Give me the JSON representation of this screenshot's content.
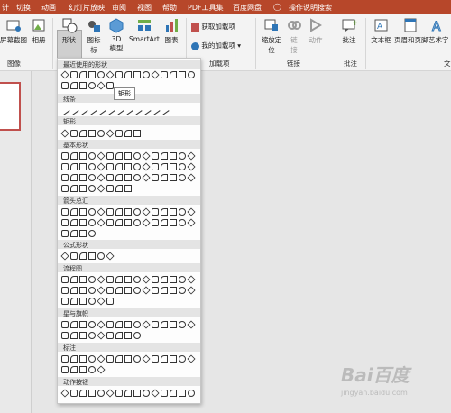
{
  "menu_tabs": [
    "计",
    "切换",
    "动画",
    "幻灯片放映",
    "审阅",
    "视图",
    "帮助",
    "PDF工具集",
    "百度网盘"
  ],
  "tell_me": "操作说明搜索",
  "ribbon": {
    "screenshot_top": "屏幕截图",
    "album": "相册",
    "shapes": "形状",
    "icons": "图标",
    "icons2": "标",
    "model3d": "3D",
    "model3d2": "模型",
    "smartart": "SmartArt",
    "chart": "图表",
    "get_addins": "获取加载项",
    "my_addins": "我的加载项",
    "zoom": "缩放定",
    "zoom2": "位",
    "link": "链",
    "link2": "接",
    "action": "动作",
    "comment": "批注",
    "textbox": "文本框",
    "headerfooter": "页眉和页脚",
    "wordart": "艺术字"
  },
  "groups": {
    "images": "图像",
    "addins": "加载项",
    "links": "链接",
    "comments": "批注",
    "text": "文"
  },
  "dropdown": {
    "sections": [
      "最近使用的形状",
      "线条",
      "矩形",
      "基本形状",
      "箭头总汇",
      "公式形状",
      "流程图",
      "星与旗帜",
      "标注",
      "动作按钮"
    ],
    "tooltip": "矩形"
  },
  "watermark": {
    "line1": "Bai百度",
    "line2": "jingyan.baidu.com"
  },
  "colors": {
    "titlebar": "#b7472a",
    "ribbon": "#f3f3f3",
    "accent": "#c0504d"
  },
  "icons": [
    "screenshot-icon",
    "album-icon",
    "shapes-icon",
    "icons-icon",
    "3d-model-icon",
    "smartart-icon",
    "chart-icon",
    "store-icon",
    "addin-icon",
    "zoom-icon",
    "link-icon",
    "action-icon",
    "comment-icon",
    "textbox-icon",
    "header-footer-icon",
    "wordart-icon"
  ]
}
